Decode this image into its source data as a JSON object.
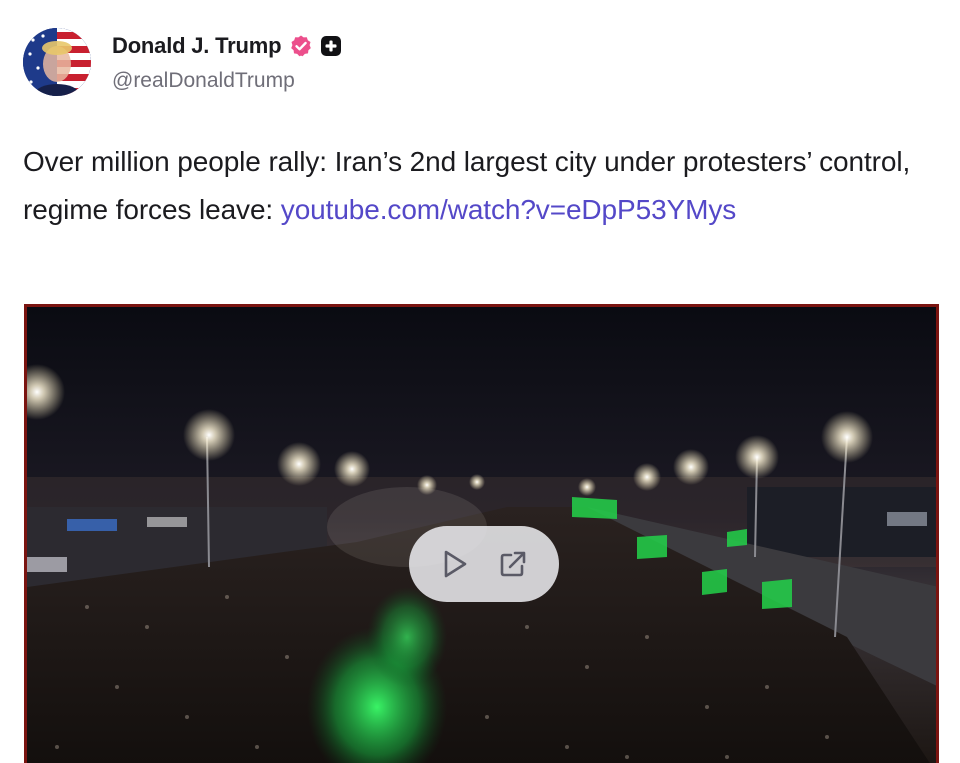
{
  "author": {
    "display_name": "Donald J. Trump",
    "handle": "@realDonaldTrump",
    "verified_icon": "verified-badge-icon",
    "badge_icon": "plus-badge-icon",
    "accent_color": "#ec4f8c"
  },
  "post": {
    "text": "Over million people rally: Iran’s 2nd largest city under protesters’ control, regime forces leave: ",
    "link_text": "youtube.com/watch?v=eDpP53YMys",
    "link_color": "#5448c8"
  },
  "media": {
    "type": "video-link-preview",
    "controls": [
      {
        "icon": "play-icon"
      },
      {
        "icon": "external-link-icon"
      }
    ]
  }
}
